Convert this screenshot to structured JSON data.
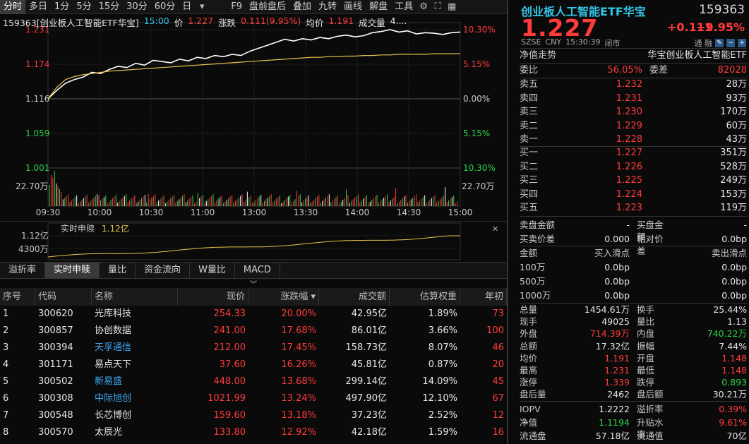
{
  "toolbar": {
    "items": [
      "分时",
      "多日",
      "1分",
      "5分",
      "15分",
      "30分",
      "60分",
      "日"
    ],
    "active": 0,
    "items2": [
      "F9",
      "盘前盘后",
      "叠加",
      "九转",
      "画线",
      "解盘",
      "工具"
    ]
  },
  "chart_header": {
    "name": "159363[创业板人工智能ETF华宝]",
    "time": "15:00",
    "price_label": "价",
    "price": "1.227",
    "change_label": "涨跌",
    "change": "0.111(9.95%)",
    "avg_label": "均价",
    "avg": "1.191",
    "vol_label": "成交量",
    "vol": "4...."
  },
  "chart_data": {
    "type": "line",
    "x_ticks": [
      "09:30",
      "10:00",
      "10:30",
      "11:00",
      "13:00",
      "13:30",
      "14:00",
      "14:30",
      "15:00"
    ],
    "y_left_ticks": [
      "1.231",
      "1.174",
      "1.116",
      "1.059",
      "1.001"
    ],
    "y_right_ticks": [
      "10.30%",
      "5.15%",
      "0.00%",
      "5.15%",
      "10.30%"
    ],
    "volume_axis_label": "22.70万",
    "ylim": [
      1.001,
      1.231
    ],
    "series": [
      {
        "color": "#ffffff",
        "points": [
          1.116,
          1.13,
          1.142,
          1.148,
          1.152,
          1.16,
          1.158,
          1.165,
          1.17,
          1.168,
          1.175,
          1.172,
          1.18,
          1.178,
          1.176,
          1.182,
          1.179,
          1.185,
          1.183,
          1.188,
          1.186,
          1.19,
          1.188,
          1.195,
          1.2,
          1.205,
          1.21,
          1.215,
          1.212,
          1.216,
          1.214,
          1.218,
          1.216,
          1.22,
          1.222,
          1.219,
          1.221,
          1.226,
          1.228,
          1.231,
          1.227,
          1.229,
          1.224,
          1.226,
          1.225,
          1.223,
          1.226,
          1.227
        ]
      },
      {
        "color": "#e8c34a",
        "points": [
          1.116,
          1.135,
          1.148,
          1.153,
          1.156,
          1.158,
          1.16,
          1.162,
          1.163,
          1.164,
          1.165,
          1.166,
          1.167,
          1.168,
          1.169,
          1.17,
          1.171,
          1.172,
          1.173,
          1.174,
          1.175,
          1.176,
          1.177,
          1.178,
          1.179,
          1.18,
          1.181,
          1.182,
          1.183,
          1.184,
          1.185,
          1.185,
          1.186,
          1.186,
          1.187,
          1.187,
          1.188,
          1.188,
          1.189,
          1.189,
          1.19,
          1.19,
          1.19,
          1.19,
          1.191,
          1.191,
          1.191,
          1.191
        ]
      }
    ]
  },
  "mini_chart": {
    "label": "实时申赎",
    "value": "1.12亿",
    "axis_top": "1.12亿",
    "axis_mid": "4300万"
  },
  "tabs": [
    "溢折率",
    "实时申赎",
    "量比",
    "资金流向",
    "W量比",
    "MACD"
  ],
  "tabs_active": 1,
  "table": {
    "headers": [
      "序号",
      "代码",
      "名称",
      "现价",
      "涨跌幅 ▾",
      "成交额",
      "估算权重",
      "年初"
    ],
    "rows": [
      {
        "no": "1",
        "code": "300620",
        "name": "光库科技",
        "price": "254.33",
        "pct": "20.00%",
        "amount": "42.95亿",
        "weight": "1.89%",
        "ytd": "73",
        "name_color": "#e6e6e6"
      },
      {
        "no": "2",
        "code": "300857",
        "name": "协创数据",
        "price": "241.00",
        "pct": "17.68%",
        "amount": "86.01亿",
        "weight": "3.66%",
        "ytd": "100",
        "name_color": "#e6e6e6"
      },
      {
        "no": "3",
        "code": "300394",
        "name": "天孚通信",
        "price": "212.00",
        "pct": "17.45%",
        "amount": "158.73亿",
        "weight": "8.07%",
        "ytd": "46",
        "name_color": "#3fa9f5"
      },
      {
        "no": "4",
        "code": "301171",
        "name": "易点天下",
        "price": "37.60",
        "pct": "16.26%",
        "amount": "45.81亿",
        "weight": "0.87%",
        "ytd": "20",
        "name_color": "#e6e6e6"
      },
      {
        "no": "5",
        "code": "300502",
        "name": "新易盛",
        "price": "448.00",
        "pct": "13.68%",
        "amount": "299.14亿",
        "weight": "14.09%",
        "ytd": "45",
        "name_color": "#3fa9f5"
      },
      {
        "no": "6",
        "code": "300308",
        "name": "中际旭创",
        "price": "1021.99",
        "pct": "13.24%",
        "amount": "497.90亿",
        "weight": "12.10%",
        "ytd": "67",
        "name_color": "#3fa9f5"
      },
      {
        "no": "7",
        "code": "300548",
        "name": "长芯博创",
        "price": "159.60",
        "pct": "13.18%",
        "amount": "37.23亿",
        "weight": "2.52%",
        "ytd": "12",
        "name_color": "#e6e6e6"
      },
      {
        "no": "8",
        "code": "300570",
        "name": "太辰光",
        "price": "133.80",
        "pct": "12.92%",
        "amount": "42.18亿",
        "weight": "1.59%",
        "ytd": "16",
        "name_color": "#e6e6e6"
      }
    ]
  },
  "quote": {
    "title": "创业板人工智能ETF华宝",
    "code": "159363",
    "price": "1.227",
    "change": "+0.111",
    "pct": "+9.95%",
    "meta": [
      "SZSE",
      "CNY",
      "15:30:39",
      "闭市"
    ],
    "meta_right": "通 融",
    "nav_label": "净值走势",
    "fund_name": "华宝创业板人工智能ETF",
    "weibi_label": "委比",
    "weibi": "56.05%",
    "weicha_label": "委差",
    "weicha": "82028",
    "asks": [
      {
        "label": "卖五",
        "price": "1.232",
        "vol": "28万"
      },
      {
        "label": "卖四",
        "price": "1.231",
        "vol": "93万"
      },
      {
        "label": "卖三",
        "price": "1.230",
        "vol": "170万"
      },
      {
        "label": "卖二",
        "price": "1.229",
        "vol": "60万"
      },
      {
        "label": "卖一",
        "price": "1.228",
        "vol": "43万"
      }
    ],
    "bids": [
      {
        "label": "买一",
        "price": "1.227",
        "vol": "351万"
      },
      {
        "label": "买二",
        "price": "1.226",
        "vol": "528万"
      },
      {
        "label": "买三",
        "price": "1.225",
        "vol": "249万"
      },
      {
        "label": "买四",
        "price": "1.224",
        "vol": "153万"
      },
      {
        "label": "买五",
        "price": "1.223",
        "vol": "119万"
      }
    ],
    "sell_amount_label": "卖盘金额",
    "sell_amount": "-",
    "buy_amount_label": "买盘金额",
    "buy_amount": "-",
    "spread_label": "买卖价差",
    "spread": "0.000",
    "rel_spread_label": "相对价差",
    "rel_spread": "0.0bp",
    "slip_headers": [
      "金额",
      "买入滑点",
      "卖出滑点"
    ],
    "slip": [
      {
        "amt": "100万",
        "buy": "0.0bp",
        "sell": "0.0bp"
      },
      {
        "amt": "500万",
        "buy": "0.0bp",
        "sell": "0.0bp"
      },
      {
        "amt": "1000万",
        "buy": "0.0bp",
        "sell": "0.0bp"
      }
    ],
    "stats": [
      {
        "a": "总量",
        "b": "1454.61万",
        "bc": "#e6e6e6",
        "c": "换手",
        "d": "25.44%",
        "dc": "#e6e6e6"
      },
      {
        "a": "现手",
        "b": "49025",
        "bc": "#e6e6e6",
        "c": "量比",
        "d": "1.13",
        "dc": "#e6e6e6"
      },
      {
        "a": "外盘",
        "b": "714.39万",
        "bc": "#ff3b3b",
        "c": "内盘",
        "d": "740.22万",
        "dc": "#2bd447"
      },
      {
        "a": "总额",
        "b": "17.32亿",
        "bc": "#e6e6e6",
        "c": "振幅",
        "d": "7.44%",
        "dc": "#e6e6e6"
      },
      {
        "a": "均价",
        "b": "1.191",
        "bc": "#ff3b3b",
        "c": "开盘",
        "d": "1.148",
        "dc": "#ff3b3b"
      },
      {
        "a": "最高",
        "b": "1.231",
        "bc": "#ff3b3b",
        "c": "最低",
        "d": "1.148",
        "dc": "#ff3b3b"
      },
      {
        "a": "涨停",
        "b": "1.339",
        "bc": "#ff3b3b",
        "c": "跌停",
        "d": "0.893",
        "dc": "#2bd447"
      },
      {
        "a": "盘后量",
        "b": "2462",
        "bc": "#e6e6e6",
        "c": "盘后额",
        "d": "30.21万",
        "dc": "#e6e6e6"
      }
    ],
    "stats2": [
      {
        "a": "IOPV",
        "b": "1.2222",
        "bc": "#e6e6e6",
        "c": "溢折率",
        "d": "0.39%",
        "dc": "#ff3b3b"
      },
      {
        "a": "净值",
        "b": "1.1194",
        "bc": "#2bd447",
        "c": "升贴水率",
        "d": "9.61%",
        "dc": "#ff3b3b"
      },
      {
        "a": "流通盘",
        "b": "57.18亿",
        "bc": "#e6e6e6",
        "c": "流通值",
        "d": "70亿",
        "dc": "#e6e6e6"
      }
    ]
  },
  "colors": {
    "up": "#ff3b3b",
    "down": "#2bd447",
    "avg": "#e8c34a",
    "accent": "#33c6e8"
  }
}
